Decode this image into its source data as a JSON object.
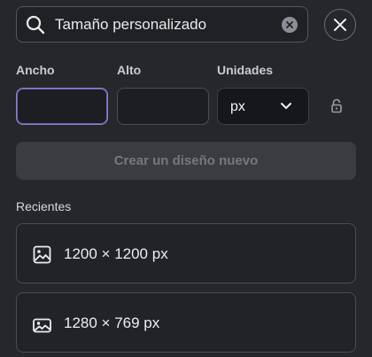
{
  "search": {
    "value": "Tamaño personalizado",
    "icon": "search-icon",
    "clear_icon": "clear-icon"
  },
  "close": {
    "icon": "close-icon"
  },
  "dimensions": {
    "width_label": "Ancho",
    "width_value": "",
    "height_label": "Alto",
    "height_value": "",
    "units_label": "Unidades",
    "units_value": "px",
    "lock_icon": "lock-icon"
  },
  "create_button": {
    "label": "Crear un diseño nuevo",
    "disabled": true
  },
  "recent": {
    "title": "Recientes",
    "items": [
      {
        "label": "1200 × 1200 px",
        "icon": "image-icon"
      },
      {
        "label": "1280 × 769 px",
        "icon": "landscape-image-icon"
      }
    ]
  },
  "colors": {
    "background": "#25272b",
    "focus_border": "#8b80c8",
    "disabled_button": "#3a3c41"
  }
}
